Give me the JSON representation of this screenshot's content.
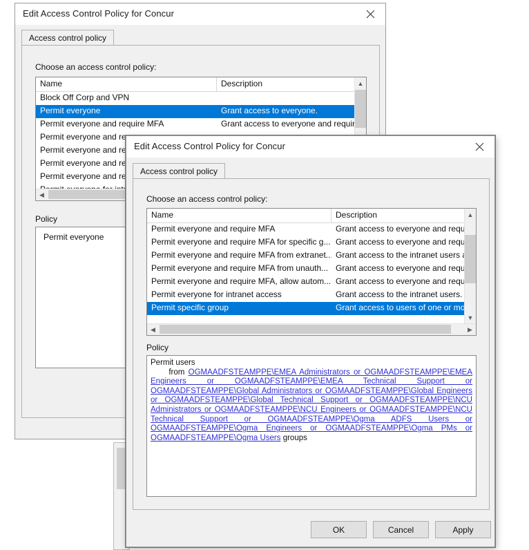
{
  "back_dialog": {
    "title": "Edit Access Control Policy for Concur",
    "close_icon": "close-icon",
    "tab_label": "Access control policy",
    "choose_label": "Choose an access control policy:",
    "columns": [
      "Name",
      "Description"
    ],
    "rows": [
      {
        "name": "Block Off Corp and VPN",
        "description": "",
        "selected": false
      },
      {
        "name": "Permit everyone",
        "description": "Grant access to everyone.",
        "selected": true
      },
      {
        "name": "Permit everyone and require MFA",
        "description": "Grant access to everyone and requir.",
        "selected": false
      },
      {
        "name": "Permit everyone and re",
        "description": "",
        "selected": false
      },
      {
        "name": "Permit everyone and re",
        "description": "",
        "selected": false
      },
      {
        "name": "Permit everyone and re",
        "description": "",
        "selected": false
      },
      {
        "name": "Permit everyone and re",
        "description": "",
        "selected": false
      },
      {
        "name": "Permit everyone for intra",
        "description": "",
        "selected": false
      }
    ],
    "scroll_left_arrow": "chevron-left-icon",
    "scroll_up_arrow": "chevron-up-icon",
    "policy_label": "Policy",
    "policy_text": "Permit everyone"
  },
  "front_dialog": {
    "title": "Edit Access Control Policy for Concur",
    "close_icon": "close-icon",
    "tab_label": "Access control policy",
    "choose_label": "Choose an access control policy:",
    "columns": [
      "Name",
      "Description"
    ],
    "rows": [
      {
        "name": "Permit everyone and require MFA",
        "description": "Grant access to everyone and requir.",
        "selected": false
      },
      {
        "name": "Permit everyone and require MFA for specific g...",
        "description": "Grant access to everyone and requir.",
        "selected": false
      },
      {
        "name": "Permit everyone and require MFA from extranet...",
        "description": "Grant access to the intranet users an",
        "selected": false
      },
      {
        "name": "Permit everyone and require MFA from unauth...",
        "description": "Grant access to everyone and requir.",
        "selected": false
      },
      {
        "name": "Permit everyone and require MFA, allow autom...",
        "description": "Grant access to everyone and requir.",
        "selected": false
      },
      {
        "name": "Permit everyone for intranet access",
        "description": "Grant access to the intranet users.",
        "selected": false
      },
      {
        "name": "Permit specific group",
        "description": "Grant access to users of one or more",
        "selected": true
      }
    ],
    "scroll_up_arrow": "chevron-up-icon",
    "scroll_down_arrow": "chevron-down-icon",
    "scroll_left_arrow": "chevron-left-icon",
    "scroll_right_arrow": "chevron-right-icon",
    "policy_label": "Policy",
    "policy_text": {
      "line1_plain": "Permit users",
      "line2_prefix": "     from ",
      "groups_text": "OGMAADFSTEAMPPE\\EMEA Administrators or OGMAADFSTEAMPPE\\EMEA Engineers or OGMAADFSTEAMPPE\\EMEA Technical Support or OGMAADFSTEAMPPE\\Global Administrators or OGMAADFSTEAMPPE\\Global Engineers or OGMAADFSTEAMPPE\\Global Technical Support or OGMAADFSTEAMPPE\\NCU Administrators or OGMAADFSTEAMPPE\\NCU Engineers or OGMAADFSTEAMPPE\\NCU Technical Support or OGMAADFSTEAMPPE\\Ogma ADFS Users or OGMAADFSTEAMPPE\\Ogma Engineers or OGMAADFSTEAMPPE\\Ogma PMs or OGMAADFSTEAMPPE\\Ogma Users",
      "suffix_plain": " groups"
    },
    "buttons": {
      "ok": "OK",
      "cancel": "Cancel",
      "apply": "Apply"
    }
  },
  "colors": {
    "selection_blue": "#0078d7",
    "link_blue": "#2f2fd8",
    "dialog_face": "#f0f0f0",
    "button_face": "#e1e1e1"
  }
}
